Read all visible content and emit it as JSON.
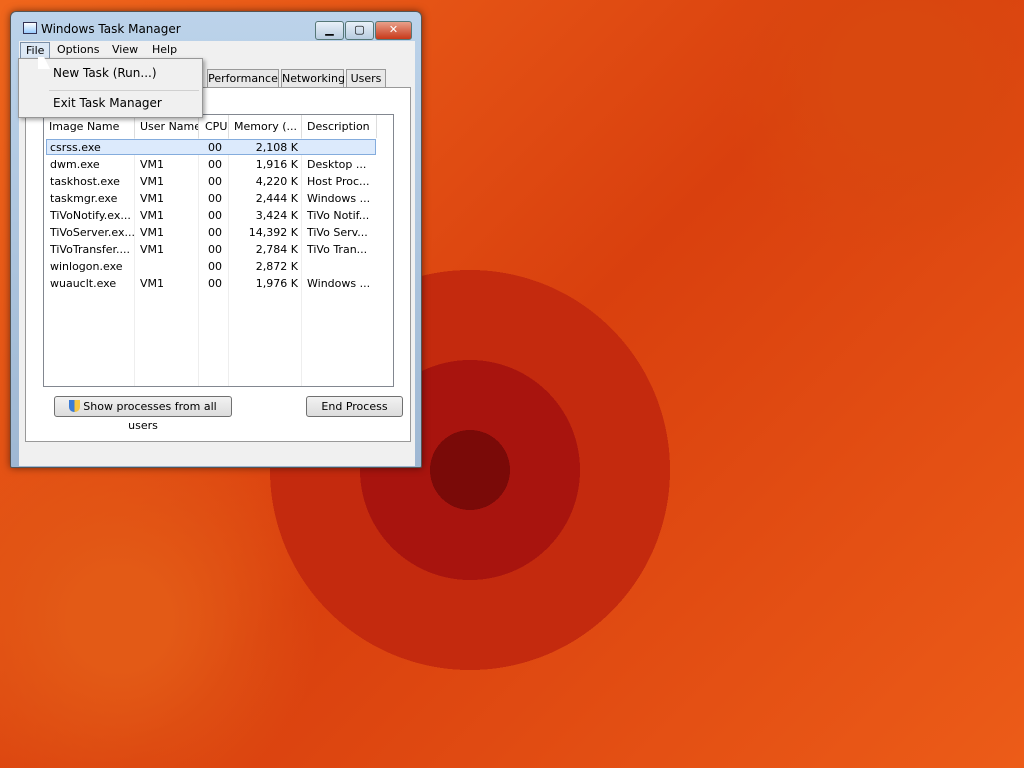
{
  "window": {
    "title": "Windows Task Manager",
    "minimize": "▁",
    "maximize": "▢",
    "close": "✕"
  },
  "menubar": [
    "File",
    "Options",
    "View",
    "Help"
  ],
  "file_menu": [
    "New Task (Run...)",
    "Exit Task Manager"
  ],
  "tabs": [
    "Performance",
    "Networking",
    "Users"
  ],
  "columns": [
    "Image Name",
    "User Name",
    "CPU",
    "Memory (...",
    "Description"
  ],
  "rows": [
    [
      "csrss.exe",
      "",
      "00",
      "2,108 K",
      ""
    ],
    [
      "dwm.exe",
      "VM1",
      "00",
      "1,916 K",
      "Desktop ..."
    ],
    [
      "taskhost.exe",
      "VM1",
      "00",
      "4,220 K",
      "Host Proc..."
    ],
    [
      "taskmgr.exe",
      "VM1",
      "00",
      "2,444 K",
      "Windows ..."
    ],
    [
      "TiVoNotify.ex...",
      "VM1",
      "00",
      "3,424 K",
      "TiVo Notif..."
    ],
    [
      "TiVoServer.ex...",
      "VM1",
      "00",
      "14,392 K",
      "TiVo Serv..."
    ],
    [
      "TiVoTransfer....",
      "VM1",
      "00",
      "2,784 K",
      "TiVo Tran..."
    ],
    [
      "winlogon.exe",
      "",
      "00",
      "2,872 K",
      ""
    ],
    [
      "wuauclt.exe",
      "VM1",
      "00",
      "1,976 K",
      "Windows ..."
    ]
  ],
  "buttons": {
    "show_all": "Show processes from all users",
    "end_process": "End Process"
  }
}
